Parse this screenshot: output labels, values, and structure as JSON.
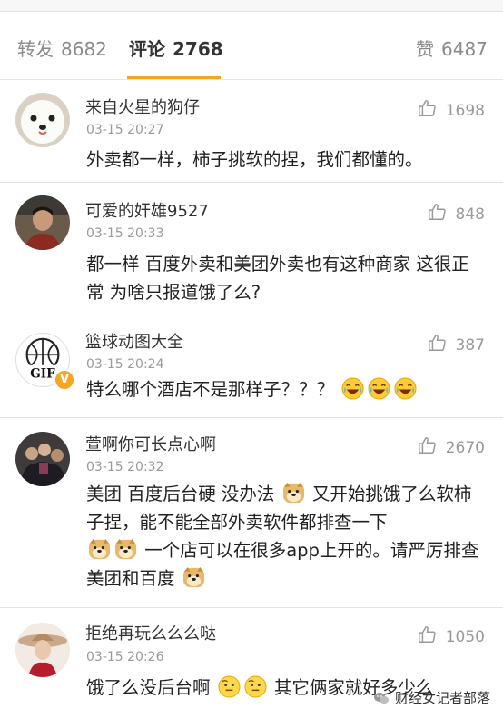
{
  "tabs": {
    "repost": {
      "label": "转发",
      "count": "8682"
    },
    "comment": {
      "label": "评论",
      "count": "2768"
    },
    "like": {
      "label": "赞",
      "count": "6487"
    }
  },
  "comments": [
    {
      "username": "来自火星的狗仔",
      "time": "03-15 20:27",
      "likes": "1698",
      "text": "外卖都一样，柿子挑软的捏，我们都懂的。",
      "avatar_icon": "white-dog-avatar"
    },
    {
      "username": "可爱的奸雄9527",
      "time": "03-15 20:33",
      "likes": "848",
      "text": "都一样 百度外卖和美团外卖也有这种商家 这很正常 为啥只报道饿了么?",
      "avatar_icon": "man-photo-avatar"
    },
    {
      "username": "篮球动图大全",
      "time": "03-15 20:24",
      "likes": "387",
      "text_parts": [
        "特么哪个酒店不是那样子？？？"
      ],
      "emojis": [
        "laugh-cry-emoji",
        "laugh-cry-emoji",
        "laugh-cry-emoji"
      ],
      "avatar_icon": "basketball-gif-avatar",
      "verified": "V",
      "avatar_label": "GIF"
    },
    {
      "username": "萱啊你可长点心啊",
      "time": "03-15 20:32",
      "likes": "2670",
      "text_parts": [
        "美团 百度后台硬 没办法",
        "又开始挑饿了么软柿子捏，能不能全部外卖软件都排查一下",
        "一个店可以在很多app上开的。请严厉排查美团和百度"
      ],
      "emojis": [
        "doge-emoji"
      ],
      "avatar_icon": "group-photo-avatar"
    },
    {
      "username": "拒绝再玩么么么哒",
      "time": "03-15 20:26",
      "likes": "1050",
      "text_parts": [
        "饿了么没后台啊",
        "其它俩家就好多少么"
      ],
      "emojis": [
        "thinking-emoji"
      ],
      "avatar_icon": "woman-hat-avatar"
    }
  ],
  "watermark": "财经女记者部落",
  "colors": {
    "accent": "#f5a623",
    "text": "#333333",
    "muted": "#9a9a9a"
  }
}
